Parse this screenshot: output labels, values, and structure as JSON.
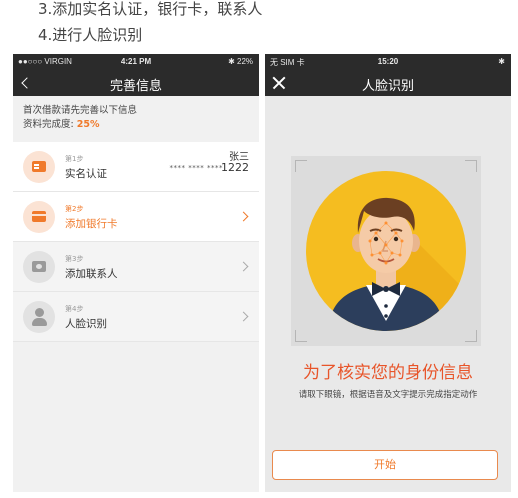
{
  "captions": {
    "line3": "3.添加实名认证，银行卡，联系人",
    "line4": "4.进行人脸识别"
  },
  "left_screen": {
    "status": {
      "carrier": "●●○○○ VIRGIN",
      "time": "4:21 PM",
      "battery": "✱ 22%"
    },
    "title": "完善信息",
    "notice": "首次借款请先完善以下信息",
    "completion_label": "资料完成度:",
    "completion_value": "25%",
    "steps": [
      {
        "num": "第1步",
        "label": "实名认证",
        "name": "张三",
        "masked": "**** **** ****",
        "last4": "1222",
        "status": "done"
      },
      {
        "num": "第2步",
        "label": "添加银行卡",
        "status": "active"
      },
      {
        "num": "第3步",
        "label": "添加联系人",
        "status": "pending"
      },
      {
        "num": "第4步",
        "label": "人脸识别",
        "status": "pending"
      }
    ]
  },
  "right_screen": {
    "status": {
      "carrier": "无 SIM 卡",
      "time": "15:20",
      "battery": "✱"
    },
    "title": "人脸识别",
    "headline": "为了核实您的身份信息",
    "instruction": "请取下眼镜，根据语音及文字提示完成指定动作",
    "start_button": "开始"
  },
  "colors": {
    "accent": "#f07a2b",
    "headline": "#e8552a",
    "dark_bar": "#2b2b2b",
    "avatar_bg": "#f5bd20"
  },
  "icons": [
    "back-icon",
    "close-icon",
    "id-card-icon",
    "bank-card-icon",
    "contacts-icon",
    "person-icon",
    "chevron-right-icon",
    "face-avatar-illustration"
  ]
}
